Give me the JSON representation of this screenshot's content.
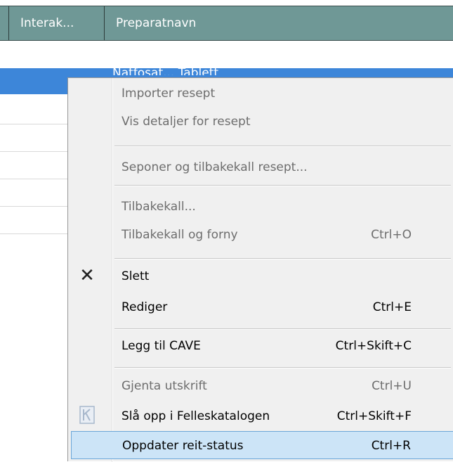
{
  "table": {
    "columns": [
      "Interak...",
      "Preparatnavn"
    ],
    "selected_row_text": "Natfosat... Tablett"
  },
  "context_menu": {
    "items": [
      {
        "label": "Importer resept",
        "shortcut": "",
        "enabled": false
      },
      {
        "label": "Vis detaljer for resept",
        "shortcut": "",
        "enabled": false
      },
      {
        "label": "Seponer og tilbakekall resept...",
        "shortcut": "",
        "enabled": false
      },
      {
        "label": "Tilbakekall...",
        "shortcut": "",
        "enabled": false
      },
      {
        "label": "Tilbakekall og forny",
        "shortcut": "Ctrl+O",
        "enabled": false
      },
      {
        "label": "Slett",
        "shortcut": "",
        "enabled": true,
        "icon": "delete-x-icon"
      },
      {
        "label": "Rediger",
        "shortcut": "Ctrl+E",
        "enabled": true
      },
      {
        "label": "Legg til CAVE",
        "shortcut": "Ctrl+Skift+C",
        "enabled": true
      },
      {
        "label": "Gjenta utskrift",
        "shortcut": "Ctrl+U",
        "enabled": false
      },
      {
        "label": "Slå opp i Felleskatalogen",
        "shortcut": "Ctrl+Skift+F",
        "enabled": true,
        "icon": "felleskatalogen-icon"
      },
      {
        "label": "Oppdater reit-status",
        "shortcut": "Ctrl+R",
        "enabled": true,
        "highlighted": true
      }
    ]
  },
  "colors": {
    "header": "#6f9896",
    "selection": "#3d86d9",
    "menu_background": "#f0f0f0",
    "menu_highlight": "#cce4f7"
  }
}
